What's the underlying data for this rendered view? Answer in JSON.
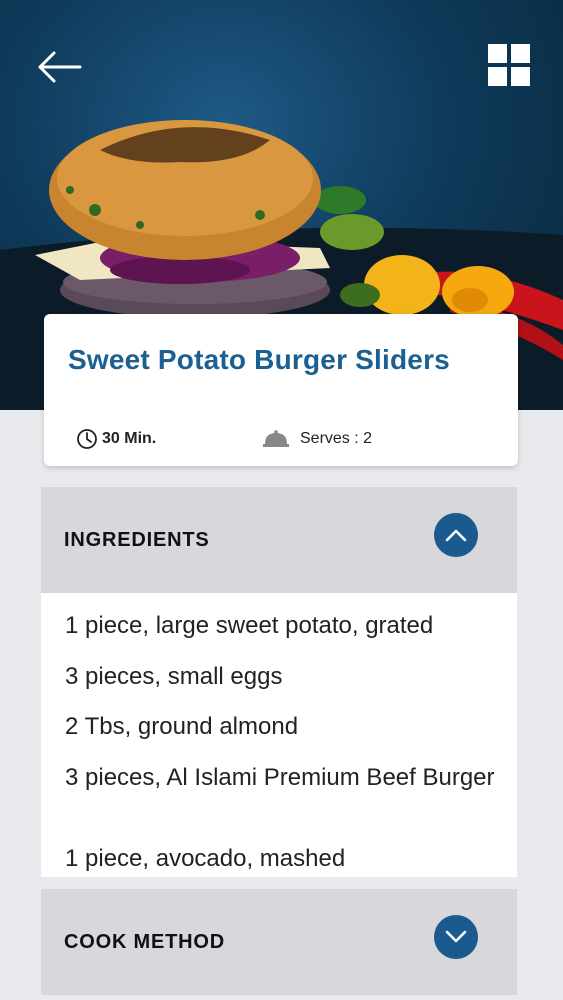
{
  "header": {
    "back_icon": "back-arrow-icon",
    "grid_icon": "grid-icon"
  },
  "recipe": {
    "title": "Sweet Potato Burger Sliders",
    "time": "30 Min.",
    "serves": "Serves : 2"
  },
  "sections": {
    "ingredients": {
      "label": "INGREDIENTS",
      "expanded": true,
      "items": [
        "1 piece, large sweet potato, grated",
        "3 pieces, small eggs",
        "2 Tbs, ground almond",
        "3 pieces, Al Islami Premium Beef Burger",
        "1 piece, avocado, mashed"
      ]
    },
    "cook_method": {
      "label": "COOK METHOD",
      "expanded": false
    }
  },
  "colors": {
    "accent": "#1b5a8e",
    "title": "#1c5f92",
    "section_bg": "#d7d8dc",
    "page_bg": "#e9eaed"
  }
}
